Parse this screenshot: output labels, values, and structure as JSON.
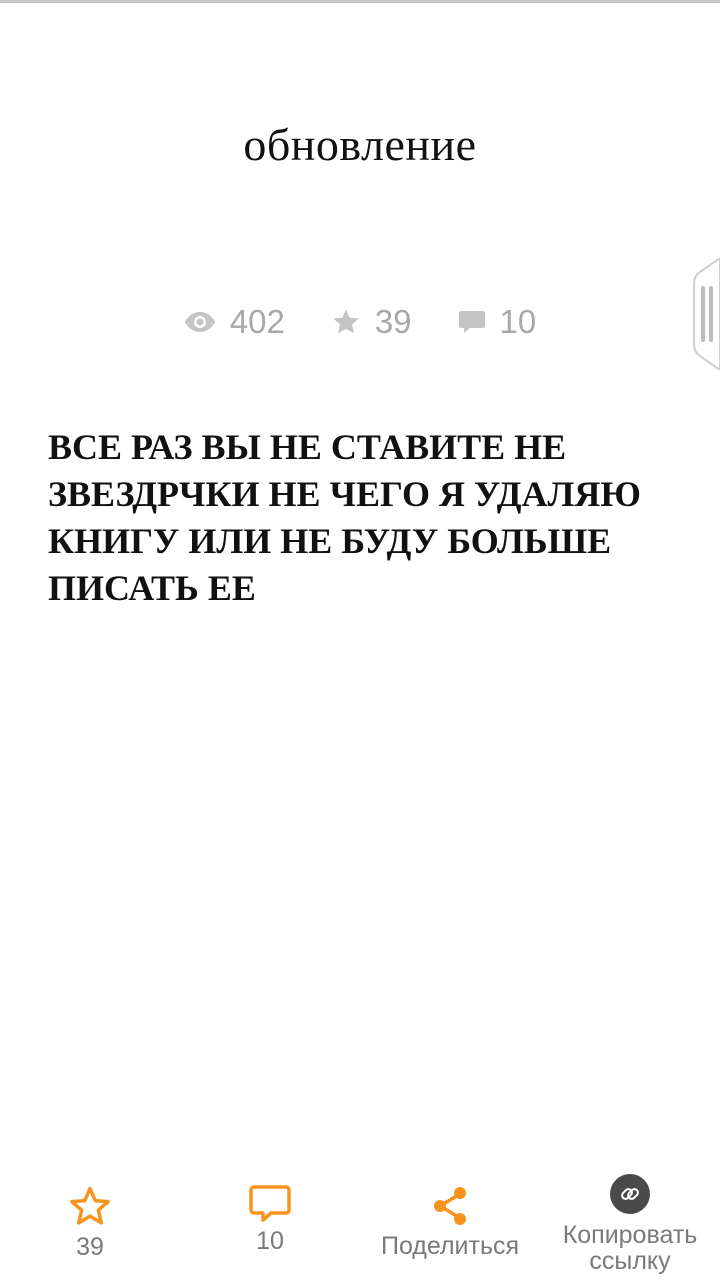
{
  "chapter": {
    "title": "обновление",
    "stats": {
      "views": "402",
      "votes": "39",
      "comments": "10"
    },
    "body": "ВСЕ РАЗ ВЫ НЕ СТАВИТЕ НЕ ЗВЕЗДРЧКИ НЕ ЧЕГО Я УДАЛЯЮ КНИГУ ИЛИ НЕ БУДУ БОЛЬШЕ ПИСАТЬ ЕЕ"
  },
  "bottom_bar": {
    "vote_count": "39",
    "comment_count": "10",
    "share_label": "Поделиться",
    "copy_label_line1": "Копировать",
    "copy_label_line2": "ссылку"
  },
  "icons": {
    "views": "eye-icon",
    "votes": "star-icon",
    "comments": "comment-icon",
    "vote_button": "star-outline-icon",
    "comment_button": "speech-bubble-icon",
    "share_button": "share-icon",
    "copy_button": "link-icon"
  },
  "colors": {
    "accent": "#f7941d",
    "stat_gray": "#a8a8a8",
    "label_gray": "#7a7a7a",
    "copy_circle": "#4a4a4a"
  }
}
